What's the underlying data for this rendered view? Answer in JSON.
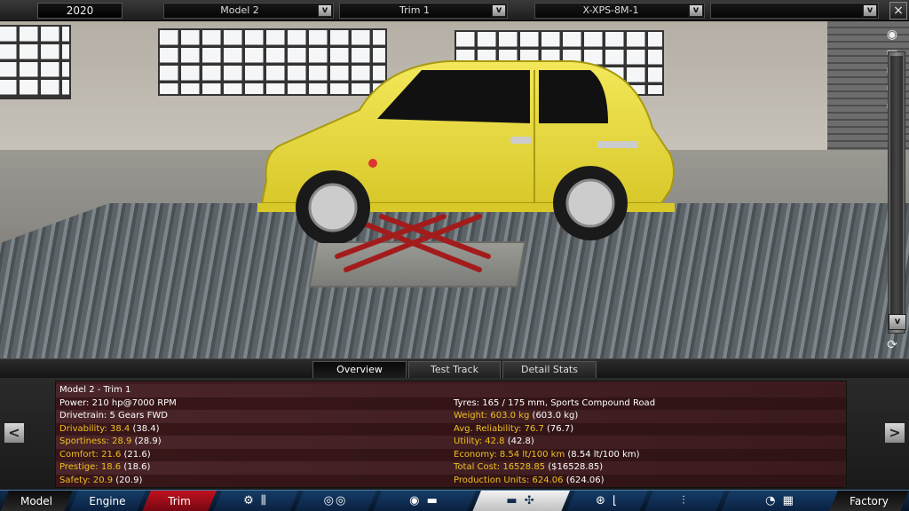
{
  "topbar": {
    "year": "2020",
    "model": "Model 2",
    "trim": "Trim 1",
    "engine": "X-XPS-8M-1",
    "extra": "",
    "dropdown_arrow": "v",
    "close_label": "×"
  },
  "scene": {
    "car_color": "#e8dc3a",
    "lift_color": "#a31c1c",
    "scroll_down_label": "v"
  },
  "tabs": [
    {
      "label": "Overview"
    },
    {
      "label": "Test Track"
    },
    {
      "label": "Detail Stats"
    }
  ],
  "info": {
    "title": "Model 2 - Trim 1",
    "left": [
      {
        "label": "Power:",
        "value": "210 hp@7000 RPM",
        "color": "white"
      },
      {
        "label": "Drivetrain:",
        "value": "5 Gears FWD",
        "color": "white"
      },
      {
        "label": "Drivability:",
        "value": "38.4",
        "paren": "(38.4)",
        "color": "yellow"
      },
      {
        "label": "Sportiness:",
        "value": "28.9",
        "paren": "(28.9)",
        "color": "yellow"
      },
      {
        "label": "Comfort:",
        "value": "21.6",
        "paren": "(21.6)",
        "color": "yellow"
      },
      {
        "label": "Prestige:",
        "value": "18.6",
        "paren": "(18.6)",
        "color": "yellow"
      },
      {
        "label": "Safety:",
        "value": "20.9",
        "paren": "(20.9)",
        "color": "yellow"
      }
    ],
    "right": [
      {
        "label": "Tyres:",
        "value": "165 / 175 mm, Sports Compound Road",
        "color": "white"
      },
      {
        "label": "Weight:",
        "value": "603.0 kg",
        "paren": "(603.0 kg)",
        "color": "yellow"
      },
      {
        "label": "Avg. Reliability:",
        "value": "76.7",
        "paren": "(76.7)",
        "color": "yellow"
      },
      {
        "label": "Utility:",
        "value": "42.8",
        "paren": "(42.8)",
        "color": "yellow"
      },
      {
        "label": "Economy:",
        "value": "8.54 lt/100 km",
        "paren": "(8.54 lt/100 km)",
        "color": "yellow"
      },
      {
        "label": "Total Cost:",
        "value": "16528.85",
        "paren": "($16528.85)",
        "color": "yellow"
      },
      {
        "label": "Production Units:",
        "value": "624.06",
        "paren": "(624.06)",
        "color": "yellow"
      }
    ],
    "prev_label": "<",
    "next_label": ">"
  },
  "bottomnav": {
    "model": "Model",
    "engine": "Engine",
    "trim": "Trim",
    "factory": "Factory",
    "icons": [
      "gearbox-icon",
      "wheels-icon",
      "chassis-icon",
      "body-icon",
      "fan-icon",
      "steering-icon",
      "seat-icon",
      "suspension-icon",
      "test-drive-icon"
    ]
  }
}
